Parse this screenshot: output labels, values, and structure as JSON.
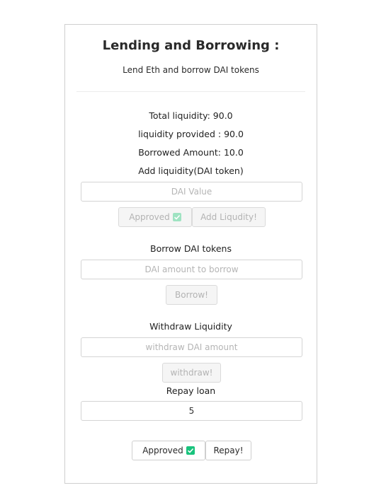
{
  "header": {
    "title": "Lending and Borrowing :",
    "subtitle": "Lend Eth and borrow DAI tokens"
  },
  "stats": {
    "total_liquidity": "Total liquidity: 90.0",
    "liquidity_provided": "liquidity provided : 90.0",
    "borrowed_amount": "Borrowed Amount: 10.0"
  },
  "add_liquidity": {
    "heading": "Add liquidity(DAI token)",
    "placeholder": "DAI Value",
    "approved_label": "Approved",
    "add_label": "Add Liqudity!"
  },
  "borrow": {
    "heading": "Borrow DAI tokens",
    "placeholder": "DAI amount to borrow",
    "button_label": "Borrow!"
  },
  "withdraw": {
    "heading": "Withdraw Liquidity",
    "placeholder": "withdraw DAI amount",
    "button_label": "withdraw!"
  },
  "repay": {
    "heading": "Repay loan",
    "value": "5",
    "approved_label": "Approved",
    "button_label": "Repay!"
  },
  "icons": {
    "approved": "check-icon",
    "accent_color": "#19c37d"
  }
}
